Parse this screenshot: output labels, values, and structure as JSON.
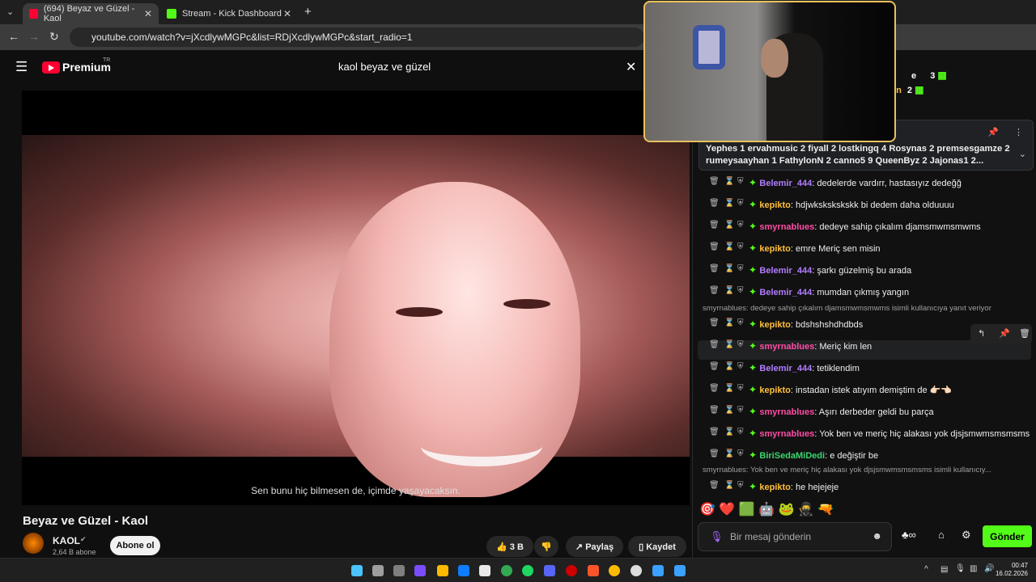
{
  "browser": {
    "tabs": [
      {
        "label": "(694) Beyaz ve Güzel - Kaol"
      },
      {
        "label": "Stream - Kick Dashboard"
      }
    ],
    "url": "youtube.com/watch?v=jXcdlywMGPc&list=RDjXcdlywMGPc&start_radio=1"
  },
  "youtube": {
    "logo": "Premium",
    "logo_region": "TR",
    "search_query": "kaol beyaz ve güzel",
    "subtitle": "Sen bunu hiç bilmesen de, içimde yaşayacaksın.",
    "title": "Beyaz ve Güzel - Kaol",
    "channel": "KAOL",
    "subscribers": "2,64 B abone",
    "subscribe_label": "Abone ol",
    "likes": "3 B",
    "share_label": "Paylaş",
    "save_label": "Kaydet"
  },
  "chat": {
    "leaderboard_top": [
      {
        "name": "e",
        "count": "3"
      },
      {
        "name": "en",
        "count": "2"
      }
    ],
    "pinned_text": "Yephes 1 ervahmusic 2 fiyall 2 lostkingq 4 Rosynas 2 premsesgamze 2 rumeysaayhan 1 FathylonN 2 canno5 9 QueenByz 2 Jajonas1 2...",
    "messages": [
      {
        "user": "Belemir_444",
        "text": "dedelerde vardırr, hastasıyız dedeğğ",
        "color": "#b27cff"
      },
      {
        "user": "kepikto",
        "text": "hdjwkskskskskk bi dedem daha olduuuu",
        "color": "#ffbf3b"
      },
      {
        "user": "smyrnablues",
        "text": "dedeye sahip çıkalım djamsmwmsmwms",
        "color": "#ff4da6"
      },
      {
        "user": "kepikto",
        "text": "emre Meriç sen misin",
        "color": "#ffbf3b"
      },
      {
        "user": "Belemir_444",
        "text": "şarkı güzelmiş bu arada",
        "color": "#b27cff"
      },
      {
        "user": "Belemir_444",
        "text": "mumdan çıkmış yangın",
        "color": "#b27cff"
      },
      {
        "user": "kepikto",
        "text": "bdshshshdhdbds",
        "color": "#ffbf3b"
      },
      {
        "user": "smyrnablues",
        "text": "Meriç kim len",
        "color": "#ff4da6"
      },
      {
        "user": "Belemir_444",
        "text": "tetiklendim",
        "color": "#b27cff"
      },
      {
        "user": "kepikto",
        "text": "instadan istek atıyım demiştim de 👉🏻👈🏻",
        "color": "#ffbf3b"
      },
      {
        "user": "smyrnablues",
        "text": "Aşırı derbeder geldi bu parça",
        "color": "#ff4da6"
      },
      {
        "user": "smyrnablues",
        "text": "Yok ben ve meriç hiç alakası yok djsjsmwmsmsmsms",
        "color": "#ff4da6"
      },
      {
        "user": "BiriSedaMiDedi",
        "text": "e değiştir be",
        "color": "#3bd46f"
      },
      {
        "user": "kepikto",
        "text": "he hejejeje",
        "color": "#ffbf3b"
      }
    ],
    "reply_1": "smyrnablues: dedeye sahip çıkalım djamsmwmsmwms isimli kullanıcıya yanıt veriyor",
    "reply_2": "smyrnablues: Yok ben ve meriç hiç alakası yok djsjsmwmsmsmsms isimli kullanıcıy...",
    "input_placeholder": "Bir mesaj gönderin",
    "send_label": "Gönder"
  },
  "taskbar": {
    "time": "00:47",
    "date": "16.02.2026"
  },
  "colors": {
    "kick_green": "#53fc18",
    "youtube_red": "#ff0033",
    "webcam_border": "#e8c25d"
  }
}
